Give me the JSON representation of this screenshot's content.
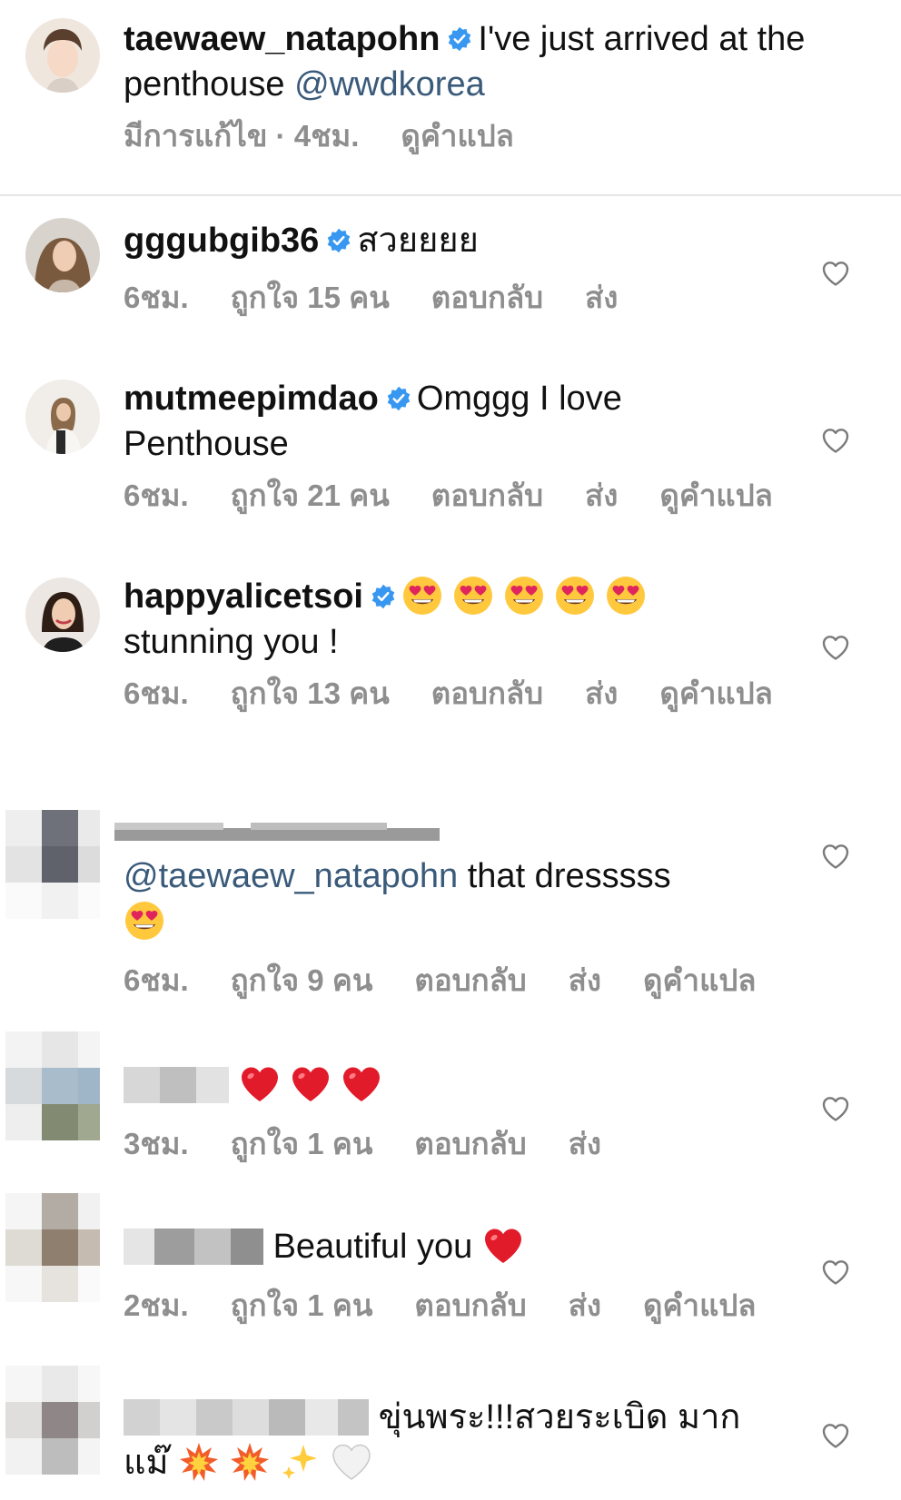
{
  "caption": {
    "username": "taewaew_natapohn",
    "text_before": "I've just arrived at the penthouse ",
    "mention": "@wwdkorea",
    "edited": "มีการแก้ไข · 4ชม.",
    "translate": "ดูคำแปล"
  },
  "comments": [
    {
      "username": "gggubgib36",
      "text": "สวยยยย",
      "time": "6ชม.",
      "likes": "ถูกใจ 15 คน",
      "reply": "ตอบกลับ",
      "send": "ส่ง",
      "translate": ""
    },
    {
      "username": "mutmeepimdao",
      "text": "Omggg I love Penthouse",
      "time": "6ชม.",
      "likes": "ถูกใจ 21 คน",
      "reply": "ตอบกลับ",
      "send": "ส่ง",
      "translate": "ดูคำแปล"
    },
    {
      "username": "happyalicetsoi",
      "text": "stunning you !",
      "emoji": "😍😍😍😍😍",
      "time": "6ชม.",
      "likes": "ถูกใจ 13 คน",
      "reply": "ตอบกลับ",
      "send": "ส่ง",
      "translate": "ดูคำแปล"
    },
    {
      "mention": "@taewaew_natapohn",
      "text": " that dresssss",
      "emoji": "😍",
      "time": "6ชม.",
      "likes": "ถูกใจ 9 คน",
      "reply": "ตอบกลับ",
      "send": "ส่ง",
      "translate": "ดูคำแปล"
    },
    {
      "emoji": "❤️❤️❤️",
      "time": "3ชม.",
      "likes": "ถูกใจ 1 คน",
      "reply": "ตอบกลับ",
      "send": "ส่ง",
      "translate": ""
    },
    {
      "text": "Beautiful you",
      "emoji": "❤️",
      "time": "2ชม.",
      "likes": "ถูกใจ 1 คน",
      "reply": "ตอบกลับ",
      "send": "ส่ง",
      "translate": "ดูคำแปล"
    },
    {
      "text": "ขุ่นพระ!!!สวยระเบิด มากแม๊",
      "emoji": "💥💥✨🤍"
    }
  ],
  "colors": {
    "verified": "#3897f0",
    "mention": "#3a5a7a",
    "meta": "#8e8e8e",
    "divider": "#e6e6e6"
  },
  "icons": {
    "heart": "heart-outline-icon",
    "verified": "verified-badge-icon"
  }
}
